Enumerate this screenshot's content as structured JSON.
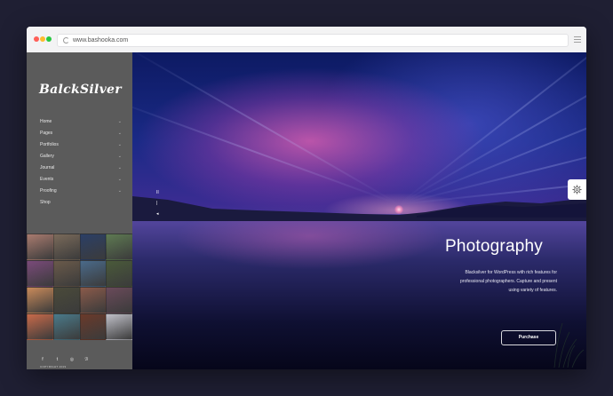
{
  "browser": {
    "url": "www.bashooka.com"
  },
  "sidebar": {
    "logo": "BalckSilver",
    "nav": [
      {
        "label": "Home",
        "chevron": "⌄"
      },
      {
        "label": "Pages",
        "chevron": "⌄"
      },
      {
        "label": "Portfolios",
        "chevron": "⌄"
      },
      {
        "label": "Gallery",
        "chevron": "⌄"
      },
      {
        "label": "Journal",
        "chevron": "⌄"
      },
      {
        "label": "Events",
        "chevron": "⌄"
      },
      {
        "label": "Proofing",
        "chevron": "⌄"
      },
      {
        "label": "Shop",
        "chevron": ""
      }
    ],
    "gallery_colors": [
      "#a97b6f",
      "#7a6a5a",
      "#2b3f66",
      "#5e7a52",
      "#7a4a7a",
      "#6a5a4a",
      "#4a6a8a",
      "#4a5a3a",
      "#c98a5a",
      "#4a4a3a",
      "#8a5a4a",
      "#6a4a5a",
      "#c86a4a",
      "#4a7a8a",
      "#6a3a2a",
      "#c0c0c8"
    ],
    "social": [
      "f",
      "t",
      "◎",
      "ℬ"
    ],
    "copyright": "COPYRIGHT 2019"
  },
  "hero": {
    "slide_indicators": [
      "II",
      "|",
      "◂"
    ],
    "title": "Photography",
    "description_line1": "Blacksilver for WordPress with rich features for",
    "description_line2": "professional photographers. Capture and present",
    "description_line3": "using variety of features.",
    "purchase_label": "Purchase"
  }
}
